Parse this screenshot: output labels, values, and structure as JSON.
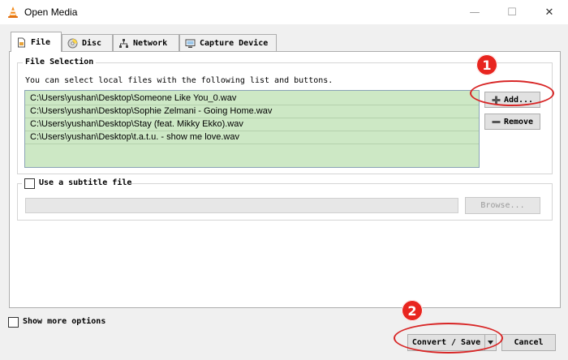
{
  "window": {
    "title": "Open Media",
    "minimize_glyph": "—",
    "maximize_glyph": "☐",
    "close_glyph": "✕"
  },
  "tabs": [
    {
      "label": "File",
      "icon": "file-icon",
      "active": true
    },
    {
      "label": "Disc",
      "icon": "disc-icon",
      "active": false
    },
    {
      "label": "Network",
      "icon": "network-icon",
      "active": false
    },
    {
      "label": "Capture Device",
      "icon": "capture-device-icon",
      "active": false
    }
  ],
  "file_selection": {
    "legend": "File Selection",
    "instructions": "You can select local files with the following list and buttons.",
    "files": [
      "C:\\Users\\yushan\\Desktop\\Someone Like You_0.wav",
      "C:\\Users\\yushan\\Desktop\\Sophie Zelmani - Going Home.wav",
      "C:\\Users\\yushan\\Desktop\\Stay (feat. Mikky Ekko).wav",
      "C:\\Users\\yushan\\Desktop\\t.a.t.u. - show me love.wav"
    ],
    "add_label": "Add...",
    "remove_label": "Remove"
  },
  "subtitle": {
    "label": "Use a subtitle file",
    "checked": false,
    "path_value": "",
    "browse_label": "Browse..."
  },
  "show_more_options": {
    "label": "Show more options",
    "checked": false
  },
  "footer": {
    "convert_save_label": "Convert / Save",
    "cancel_label": "Cancel"
  },
  "annotations": {
    "badge_1": "1",
    "badge_2": "2",
    "color": "#d82626"
  }
}
